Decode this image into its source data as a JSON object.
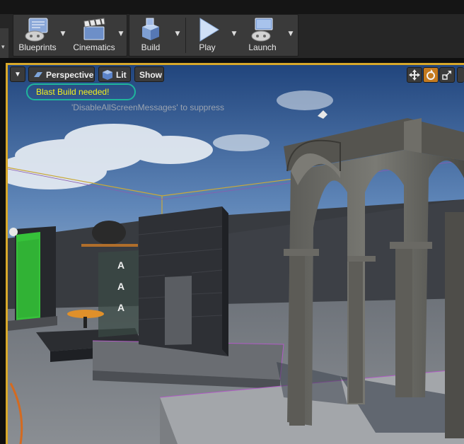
{
  "toolbar": {
    "blueprints_label": "Blueprints",
    "cinematics_label": "Cinematics",
    "build_label": "Build",
    "play_label": "Play",
    "launch_label": "Launch"
  },
  "viewport": {
    "perspective_label": "Perspective",
    "lit_label": "Lit",
    "show_label": "Show",
    "warning_text": "Blast Build needed!",
    "suppress_text": "'DisableAllScreenMessages' to suppress"
  },
  "colors": {
    "selection_outline": "#d8a82a",
    "warning_text": "#f5f01c",
    "warning_ring": "#1fb59c"
  }
}
